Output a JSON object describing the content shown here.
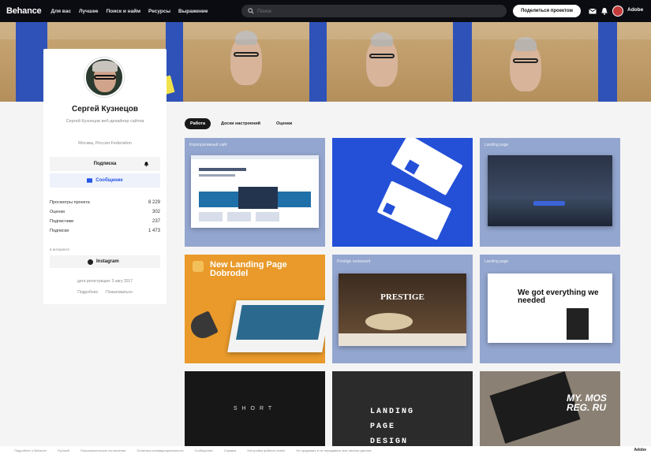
{
  "nav": {
    "logo": "Behance",
    "links": [
      "Для вас",
      "Лучшее",
      "Поиск и найм",
      "Ресурсы",
      "Выражение"
    ],
    "search_placeholder": "Поиск",
    "share_button": "Поделиться проектом",
    "adobe": "Adobe",
    "icons": [
      "mail-icon",
      "bell-icon",
      "avatar",
      "adobe-logo-icon"
    ]
  },
  "profile": {
    "name": "Сергей Кузнецов",
    "subtitle": "Сергей Кузнецов веб-дизайнер сайтов",
    "location": "Москва, Россия Federation",
    "follow_label": "Подписка",
    "message_label": "Сообщение",
    "stats": [
      {
        "label": "Просмотры проекта",
        "value": "8 229"
      },
      {
        "label": "Оценки",
        "value": "302"
      },
      {
        "label": "Подписчики",
        "value": "237"
      },
      {
        "label": "Подписки",
        "value": "1 473"
      }
    ],
    "small_label": "в интернете",
    "instagram": "Instagram",
    "recommend": "дата регистрации: 3 авгу 2017",
    "links": [
      "Подробнее",
      "Пожаловаться"
    ]
  },
  "tabs": [
    "Работа",
    "Доски настроений",
    "Оценки"
  ],
  "projects": [
    {
      "title": "Корпоративный сайт",
      "bg": "#93a6cf"
    },
    {
      "title": "",
      "bg": "#2450d8"
    },
    {
      "title": "Landing page",
      "bg": "#93a6cf"
    },
    {
      "title": "",
      "bg": "#e99a2a",
      "big_text": "New Landing Page Dobrodel"
    },
    {
      "title": "Prestige restaurant",
      "bg": "#93a6cf",
      "big_text": "PRESTIGE"
    },
    {
      "title": "Landing page",
      "bg": "#93a6cf",
      "big_text": "We got everything we needed"
    },
    {
      "title": "",
      "bg": "#171717",
      "big_text": "SHORT"
    },
    {
      "title": "",
      "bg": "#2b2b2b",
      "big_text": "LANDING PAGE DESIGN"
    },
    {
      "title": "",
      "bg": "#8a8073",
      "big_text": "MY. MOS REG. RU"
    }
  ],
  "footer": {
    "items": [
      "Подробнее о Behance",
      "Русский",
      "Пользовательское соглашение",
      "Политика конфиденциальности",
      "Сообщество",
      "Справка",
      "Настройки файлов cookie",
      "Не продавать и не передавать мои личные данные"
    ],
    "adobe": "Adobe"
  },
  "colors": {
    "accent": "#2656e8",
    "banner_blue": "#2f52b8",
    "nav": "#0b0b12"
  }
}
